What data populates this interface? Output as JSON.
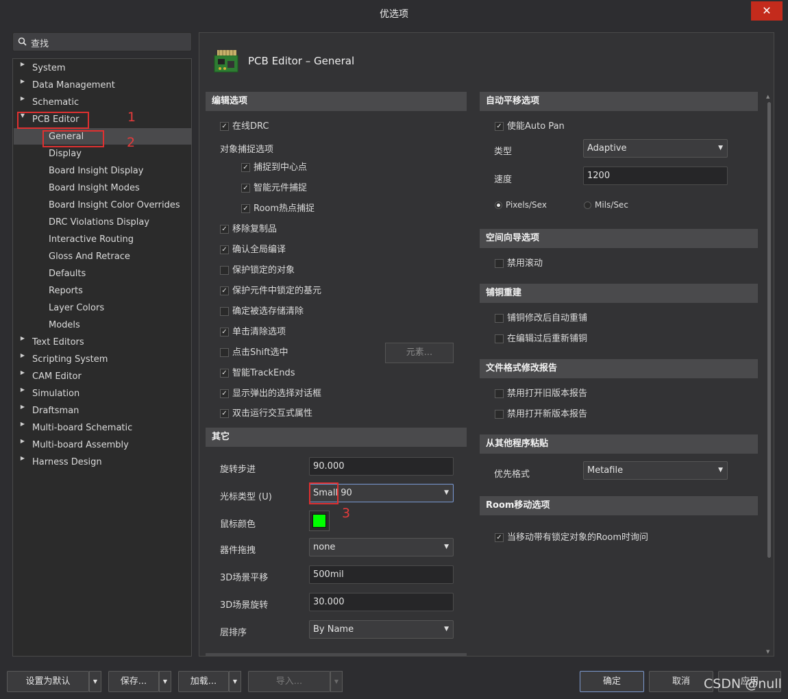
{
  "window": {
    "title": "优选项",
    "close_glyph": "✕"
  },
  "search": {
    "placeholder": "查找"
  },
  "tree": {
    "items": [
      {
        "label": "System",
        "expandable": true,
        "expanded": false
      },
      {
        "label": "Data Management",
        "expandable": true,
        "expanded": false
      },
      {
        "label": "Schematic",
        "expandable": true,
        "expanded": false
      },
      {
        "label": "PCB Editor",
        "expandable": true,
        "expanded": true
      },
      {
        "label": "General",
        "child": true,
        "selected": true
      },
      {
        "label": "Display",
        "child": true
      },
      {
        "label": "Board Insight Display",
        "child": true
      },
      {
        "label": "Board Insight Modes",
        "child": true
      },
      {
        "label": "Board Insight Color Overrides",
        "child": true
      },
      {
        "label": "DRC Violations Display",
        "child": true
      },
      {
        "label": "Interactive Routing",
        "child": true
      },
      {
        "label": "Gloss And Retrace",
        "child": true
      },
      {
        "label": "Defaults",
        "child": true
      },
      {
        "label": "Reports",
        "child": true
      },
      {
        "label": "Layer Colors",
        "child": true
      },
      {
        "label": "Models",
        "child": true
      },
      {
        "label": "Text Editors",
        "expandable": true
      },
      {
        "label": "Scripting System",
        "expandable": true
      },
      {
        "label": "CAM Editor",
        "expandable": true
      },
      {
        "label": "Simulation",
        "expandable": true
      },
      {
        "label": "Draftsman",
        "expandable": true
      },
      {
        "label": "Multi-board Schematic",
        "expandable": true
      },
      {
        "label": "Multi-board Assembly",
        "expandable": true
      },
      {
        "label": "Harness Design",
        "expandable": true
      }
    ]
  },
  "annotations": {
    "n1": "1",
    "n2": "2",
    "n3": "3"
  },
  "panel": {
    "title": "PCB Editor – General"
  },
  "editing": {
    "header": "编辑选项",
    "online_drc": "在线DRC",
    "snap_header": "对象捕捉选项",
    "snap_center": "捕捉到中心点",
    "smart_component": "智能元件捕捉",
    "room_hotspot": "Room热点捕捉",
    "remove_duplicates": "移除复制品",
    "confirm_global": "确认全局编译",
    "protect_locked": "保护锁定的对象",
    "protect_primitives": "保护元件中锁定的基元",
    "confirm_clear": "确定被选存储清除",
    "click_clear": "单击清除选项",
    "shift_select": "点击Shift选中",
    "elements_button": "元素...",
    "smart_trackends": "智能TrackEnds",
    "show_popup": "显示弹出的选择对话框",
    "dblclick": "双击运行交互式属性"
  },
  "other": {
    "header": "其它",
    "rotation_label": "旋转步进",
    "rotation_value": "90.000",
    "cursor_label": "光标类型 (U)",
    "cursor_value": "Small 90",
    "mouse_color_label": "鼠标颜色",
    "mouse_color": "#00ff00",
    "drag_label": "器件拖拽",
    "drag_value": "none",
    "pan3d_label": "3D场景平移",
    "pan3d_value": "500mil",
    "rot3d_label": "3D场景旋转",
    "rot3d_value": "30.000",
    "layer_order_label": "层排序",
    "layer_order_value": "By Name"
  },
  "autopan": {
    "header": "自动平移选项",
    "enable": "使能Auto Pan",
    "type_label": "类型",
    "type_value": "Adaptive",
    "speed_label": "速度",
    "speed_value": "1200",
    "unit_pixels": "Pixels/Sex",
    "unit_mils": "Mils/Sec"
  },
  "nav": {
    "header": "空间向导选项",
    "disable_roll": "禁用滚动"
  },
  "repour": {
    "header": "铺铜重建",
    "auto_repour": "铺铜修改后自动重铺",
    "repour_after_edit": "在编辑过后重新铺铜"
  },
  "fileformat": {
    "header": "文件格式修改报告",
    "disable_old": "禁用打开旧版本报告",
    "disable_new": "禁用打开新版本报告"
  },
  "paste": {
    "header": "从其他程序粘贴",
    "format_label": "优先格式",
    "format_value": "Metafile"
  },
  "room": {
    "header": "Room移动选项",
    "ask_locked": "当移动带有锁定对象的Room时询问"
  },
  "footer": {
    "defaults": "设置为默认",
    "save": "保存...",
    "load": "加载...",
    "import": "导入...",
    "ok": "确定",
    "cancel": "取消",
    "apply": "应用"
  },
  "watermark": "CSDN @null"
}
